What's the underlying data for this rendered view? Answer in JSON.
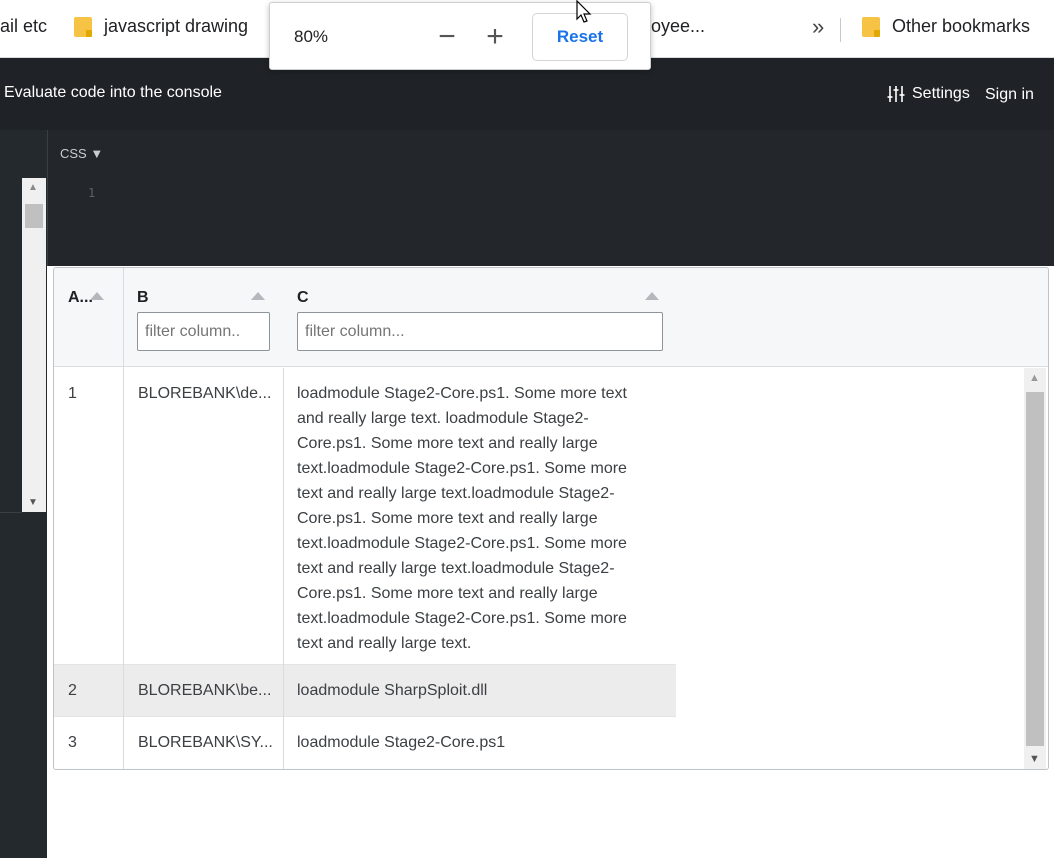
{
  "bookmarks": {
    "items": [
      {
        "label": "ail etc"
      },
      {
        "label": "javascript drawing"
      },
      {
        "label": "oyee..."
      }
    ],
    "overflow_label": "»",
    "other_label": "Other bookmarks"
  },
  "zoom_popup": {
    "percent": "80%",
    "minus_label": "−",
    "plus_label": "+",
    "reset_label": "Reset"
  },
  "toolbar": {
    "eval_label": "Evaluate code into the console",
    "settings_label": "Settings",
    "signin_label": "Sign in"
  },
  "editor": {
    "language": "CSS",
    "line_numbers": [
      "1"
    ]
  },
  "table": {
    "columns": [
      {
        "label": "A..."
      },
      {
        "label": "B",
        "filter_placeholder": "filter column.."
      },
      {
        "label": "C",
        "filter_placeholder": "filter column..."
      }
    ],
    "rows": [
      {
        "a": "1",
        "b": "BLOREBANK\\de...",
        "c": "loadmodule Stage2-Core.ps1. Some more text and really large text. loadmodule Stage2-Core.ps1. Some more text and really large text.loadmodule Stage2-Core.ps1. Some more text and really large text.loadmodule Stage2-Core.ps1. Some more text and really large text.loadmodule Stage2-Core.ps1. Some more text and really large text.loadmodule Stage2-Core.ps1. Some more text and really large text.loadmodule Stage2-Core.ps1. Some more text and really large text."
      },
      {
        "a": "2",
        "b": "BLOREBANK\\be...",
        "c": "loadmodule SharpSploit.dll"
      },
      {
        "a": "3",
        "b": "BLOREBANK\\SY...",
        "c": "loadmodule Stage2-Core.ps1"
      }
    ]
  },
  "colors": {
    "toolbar_bg": "#1f2327",
    "editor_bg": "#23272c",
    "reset_blue": "#1a73e8",
    "folder_yellow": "#f6c344",
    "highlight_row": "#ececec"
  }
}
